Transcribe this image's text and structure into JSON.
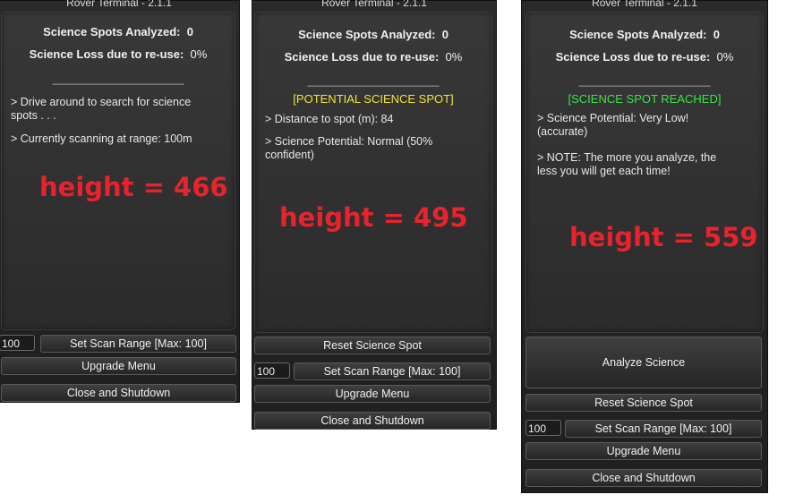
{
  "windows": [
    {
      "title": "Rover Terminal - 2.1.1",
      "stats": {
        "spots_label": "Science Spots Analyzed:",
        "spots_value": "0",
        "loss_label": "Science Loss due to re-use:",
        "loss_value": "0%"
      },
      "divider": "______________________",
      "status": "",
      "messages": [
        "> Drive around to search for science spots . . .",
        "> Currently scanning at range: 100m"
      ],
      "annotation": "height = 466",
      "scan_input_value": "100",
      "buttons": {
        "set_scan_range": "Set Scan Range [Max: 100]",
        "upgrade_menu": "Upgrade Menu",
        "close_shutdown": "Close and Shutdown"
      }
    },
    {
      "title": "Rover Terminal - 2.1.1",
      "stats": {
        "spots_label": "Science Spots Analyzed:",
        "spots_value": "0",
        "loss_label": "Science Loss due to re-use:",
        "loss_value": "0%"
      },
      "divider": "______________________",
      "status": "[POTENTIAL SCIENCE SPOT]",
      "messages": [
        "> Distance to spot (m): 84",
        "> Science Potential: Normal (50% confident)"
      ],
      "annotation": "height = 495",
      "scan_input_value": "100",
      "buttons": {
        "reset_spot": "Reset Science Spot",
        "set_scan_range": "Set Scan Range [Max: 100]",
        "upgrade_menu": "Upgrade Menu",
        "close_shutdown": "Close and Shutdown"
      }
    },
    {
      "title": "Rover Terminal - 2.1.1",
      "stats": {
        "spots_label": "Science Spots Analyzed:",
        "spots_value": "0",
        "loss_label": "Science Loss due to re-use:",
        "loss_value": "0%"
      },
      "divider": "______________________",
      "status": "[SCIENCE SPOT REACHED]",
      "messages": [
        "> Science Potential: Very Low! (accurate)",
        "> NOTE: The more you analyze, the less you will get each time!"
      ],
      "annotation": "height = 559",
      "scan_input_value": "100",
      "buttons": {
        "analyze": "Analyze Science",
        "reset_spot": "Reset Science Spot",
        "set_scan_range": "Set Scan Range [Max: 100]",
        "upgrade_menu": "Upgrade Menu",
        "close_shutdown": "Close and Shutdown"
      }
    }
  ]
}
